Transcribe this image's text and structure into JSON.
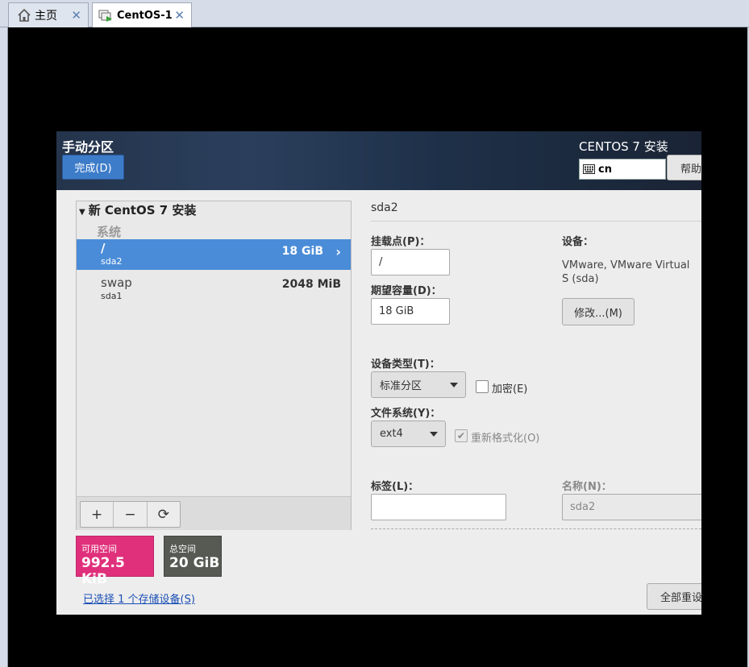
{
  "tabs": [
    {
      "label": "主页",
      "icon": "home-icon"
    },
    {
      "label": "CentOS-1",
      "icon": "vm-icon"
    }
  ],
  "installer": {
    "page_title": "手动分区",
    "done_label": "完成(D)",
    "product_title": "CENTOS 7 安装",
    "keyboard_layout": "cn",
    "help_label": "帮助"
  },
  "tree": {
    "group_title": "新 CentOS 7 安装",
    "section_label": "系统",
    "partitions": [
      {
        "mount": "/",
        "device": "sda2",
        "size": "18 GiB",
        "selected": true
      },
      {
        "mount": "swap",
        "device": "sda1",
        "size": "2048 MiB",
        "selected": false
      }
    ],
    "toolbar": {
      "add": "+",
      "remove": "−",
      "refresh": "⟳"
    }
  },
  "space": {
    "available_label": "可用空间",
    "available_value": "992.5 KiB",
    "total_label": "总空间",
    "total_value": "20 GiB",
    "available_color": "#e0307b",
    "total_color": "#575a53"
  },
  "storage_link": "已选择 1 个存储设备(S)",
  "detail": {
    "title": "sda2",
    "mount_label": "挂载点(P)：",
    "mount_value": "/",
    "capacity_label": "期望容量(D)：",
    "capacity_value": "18 GiB",
    "device_label": "设备：",
    "device_value": "VMware, VMware Virtual S (sda)",
    "modify_label": "修改...(M)",
    "device_type_label": "设备类型(T)：",
    "device_type_value": "标准分区",
    "encrypt_label": "加密(E)",
    "encrypt_checked": false,
    "fs_label": "文件系统(Y)：",
    "fs_value": "ext4",
    "reformat_label": "重新格式化(O)",
    "reformat_checked": true,
    "tag_label": "标签(L)：",
    "tag_value": "",
    "name_label": "名称(N)：",
    "name_value": "sda2",
    "reset_label": "全部重设"
  }
}
